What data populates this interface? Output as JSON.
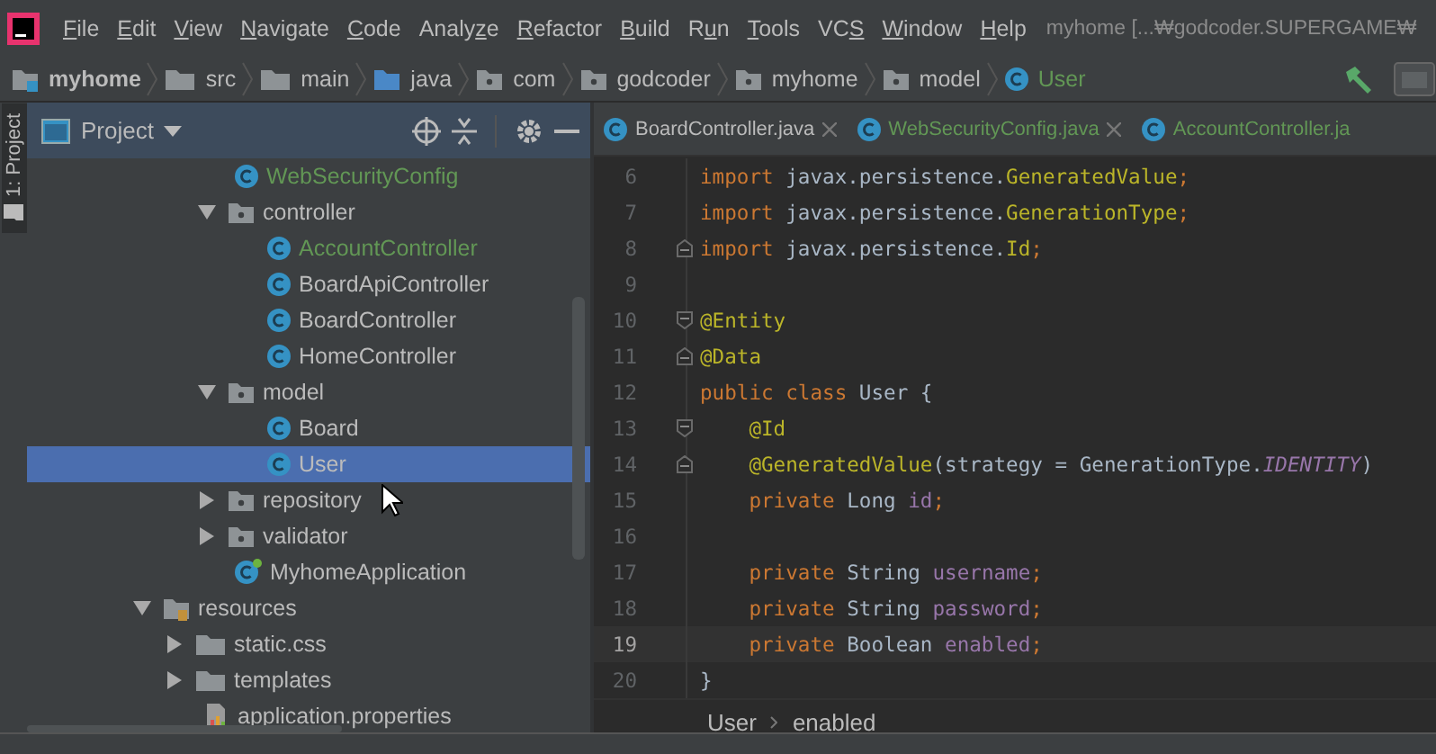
{
  "menu": [
    {
      "key": "F",
      "post": "ile"
    },
    {
      "key": "E",
      "post": "dit"
    },
    {
      "key": "V",
      "post": "iew"
    },
    {
      "key": "N",
      "post": "avigate"
    },
    {
      "key": "C",
      "post": "ode"
    },
    {
      "pre": "Analy",
      "key": "z",
      "post": "e"
    },
    {
      "key": "R",
      "post": "efactor"
    },
    {
      "key": "B",
      "post": "uild"
    },
    {
      "pre": "R",
      "key": "u",
      "post": "n"
    },
    {
      "key": "T",
      "post": "ools"
    },
    {
      "pre": "VC",
      "key": "S"
    },
    {
      "key": "W",
      "post": "indow"
    },
    {
      "key": "H",
      "post": "elp"
    }
  ],
  "window": {
    "title": "myhome [...₩godcoder.SUPERGAME₩"
  },
  "navigation": [
    {
      "kind": "project",
      "label": "myhome"
    },
    {
      "kind": "folder",
      "label": "src"
    },
    {
      "kind": "folder",
      "label": "main"
    },
    {
      "kind": "source",
      "label": "java"
    },
    {
      "kind": "package",
      "label": "com"
    },
    {
      "kind": "package",
      "label": "godcoder"
    },
    {
      "kind": "package",
      "label": "myhome"
    },
    {
      "kind": "package",
      "label": "model"
    },
    {
      "kind": "class",
      "label": "User"
    }
  ],
  "side_tab": {
    "label": "1: Project"
  },
  "project": {
    "title": "Project",
    "package_items": [
      {
        "kind": "class",
        "label": "WebSecurityConfig",
        "color": "#629755",
        "selected": false
      },
      {
        "kind": "package",
        "label": "controller",
        "expanded": true,
        "selected": false,
        "children": [
          {
            "kind": "class",
            "label": "AccountController",
            "color": "#629755",
            "selected": false
          },
          {
            "kind": "class",
            "label": "BoardApiController",
            "color": "#bbbbbb",
            "selected": false
          },
          {
            "kind": "class",
            "label": "BoardController",
            "color": "#bbbbbb",
            "selected": false
          },
          {
            "kind": "class",
            "label": "HomeController",
            "color": "#bbbbbb",
            "selected": false
          }
        ]
      },
      {
        "kind": "package",
        "label": "model",
        "expanded": true,
        "selected": false,
        "children": [
          {
            "kind": "class",
            "label": "Board",
            "color": "#bbbbbb",
            "selected": false
          },
          {
            "kind": "class",
            "label": "User",
            "color": "#bbbbbb",
            "selected": true
          }
        ]
      },
      {
        "kind": "package",
        "label": "repository",
        "expanded": false,
        "selected": false
      },
      {
        "kind": "package",
        "label": "validator",
        "expanded": false,
        "selected": false
      },
      {
        "kind": "app",
        "label": "MyhomeApplication",
        "color": "#bbbbbb",
        "selected": false
      }
    ],
    "root_items": [
      {
        "kind": "resources",
        "label": "resources",
        "expanded": true,
        "selected": false,
        "children": [
          {
            "kind": "folder",
            "label": "static.css",
            "expanded": false,
            "selected": false
          },
          {
            "kind": "folder",
            "label": "templates",
            "expanded": false,
            "selected": false
          },
          {
            "kind": "properties",
            "label": "application.properties",
            "color": "#bbbbbb",
            "selected": false
          }
        ]
      }
    ]
  },
  "tabs": [
    {
      "label": "BoardController.java",
      "color": "#bbbbbb",
      "closable": true
    },
    {
      "label": "WebSecurityConfig.java",
      "color": "#629755",
      "closable": true
    },
    {
      "label": "AccountController.ja",
      "color": "#629755",
      "closable": false
    }
  ],
  "code": [
    {
      "number": "6",
      "current": false,
      "tokens": [
        {
          "kind": "keyword",
          "text": "import"
        },
        {
          "kind": "plain",
          "text": " javax.persistence."
        },
        {
          "kind": "annotation",
          "text": "GeneratedValue"
        },
        {
          "kind": "keyword",
          "text": ";"
        }
      ]
    },
    {
      "number": "7",
      "current": false,
      "tokens": [
        {
          "kind": "keyword",
          "text": "import"
        },
        {
          "kind": "plain",
          "text": " javax.persistence."
        },
        {
          "kind": "annotation",
          "text": "GenerationType"
        },
        {
          "kind": "keyword",
          "text": ";"
        }
      ]
    },
    {
      "number": "8",
      "current": false,
      "fold_marker": {
        "kind": "end"
      },
      "tokens": [
        {
          "kind": "keyword",
          "text": "import"
        },
        {
          "kind": "plain",
          "text": " javax.persistence."
        },
        {
          "kind": "annotation",
          "text": "Id"
        },
        {
          "kind": "keyword",
          "text": ";"
        }
      ]
    },
    {
      "number": "9",
      "current": false
    },
    {
      "number": "10",
      "current": false,
      "fold_marker": {
        "kind": "start"
      },
      "tokens": [
        {
          "kind": "annotation",
          "text": "@Entity"
        }
      ]
    },
    {
      "number": "11",
      "current": false,
      "fold_marker": {
        "kind": "end"
      },
      "tokens": [
        {
          "kind": "annotation",
          "text": "@Data"
        }
      ]
    },
    {
      "number": "12",
      "current": false,
      "tokens": [
        {
          "kind": "keyword",
          "text": "public class"
        },
        {
          "kind": "plain",
          "text": " User {"
        }
      ]
    },
    {
      "number": "13",
      "current": false,
      "indented": true,
      "fold_marker": {
        "kind": "start"
      },
      "tokens": [
        {
          "kind": "annotation",
          "text": "@Id"
        }
      ]
    },
    {
      "number": "14",
      "current": false,
      "indented": true,
      "fold_marker": {
        "kind": "end"
      },
      "tokens": [
        {
          "kind": "annotation",
          "text": "@GeneratedValue"
        },
        {
          "kind": "plain",
          "text": "(strategy = GenerationType."
        },
        {
          "kind": "constant",
          "text": "IDENTITY"
        },
        {
          "kind": "plain",
          "text": ")"
        }
      ]
    },
    {
      "number": "15",
      "current": false,
      "indented": true,
      "tokens": [
        {
          "kind": "keyword",
          "text": "private"
        },
        {
          "kind": "plain",
          "text": " Long "
        },
        {
          "kind": "field",
          "text": "id"
        },
        {
          "kind": "keyword",
          "text": ";"
        }
      ]
    },
    {
      "number": "16",
      "current": false
    },
    {
      "number": "17",
      "current": false,
      "indented": true,
      "tokens": [
        {
          "kind": "keyword",
          "text": "private"
        },
        {
          "kind": "plain",
          "text": " String "
        },
        {
          "kind": "field",
          "text": "username"
        },
        {
          "kind": "keyword",
          "text": ";"
        }
      ]
    },
    {
      "number": "18",
      "current": false,
      "indented": true,
      "tokens": [
        {
          "kind": "keyword",
          "text": "private"
        },
        {
          "kind": "plain",
          "text": " String "
        },
        {
          "kind": "field",
          "text": "password"
        },
        {
          "kind": "keyword",
          "text": ";"
        }
      ]
    },
    {
      "number": "19",
      "current": true,
      "indented": true,
      "tokens": [
        {
          "kind": "keyword",
          "text": "private"
        },
        {
          "kind": "plain",
          "text": " Boolean "
        },
        {
          "kind": "field",
          "text": "enabled"
        },
        {
          "kind": "keyword",
          "text": ";"
        }
      ]
    },
    {
      "number": "20",
      "current": false,
      "tokens": [
        {
          "kind": "plain",
          "text": "}"
        }
      ]
    }
  ],
  "editor_breadcrumb": [
    "User",
    "enabled"
  ]
}
